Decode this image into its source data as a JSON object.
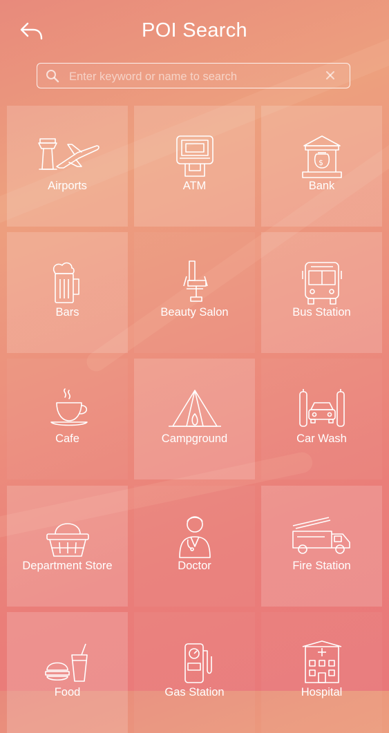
{
  "header": {
    "title": "POI Search"
  },
  "search": {
    "placeholder": "Enter keyword or name to search",
    "value": ""
  },
  "categories": [
    {
      "label": "Airports",
      "icon": "airport-icon"
    },
    {
      "label": "ATM",
      "icon": "atm-icon"
    },
    {
      "label": "Bank",
      "icon": "bank-icon"
    },
    {
      "label": "Bars",
      "icon": "beer-mug-icon"
    },
    {
      "label": "Beauty Salon",
      "icon": "salon-chair-icon"
    },
    {
      "label": "Bus Station",
      "icon": "bus-icon"
    },
    {
      "label": "Cafe",
      "icon": "coffee-cup-icon"
    },
    {
      "label": "Campground",
      "icon": "tent-icon"
    },
    {
      "label": "Car Wash",
      "icon": "car-wash-icon"
    },
    {
      "label": "Department Store",
      "icon": "shopping-basket-icon"
    },
    {
      "label": "Doctor",
      "icon": "doctor-icon"
    },
    {
      "label": "Fire Station",
      "icon": "fire-truck-icon"
    },
    {
      "label": "Food",
      "icon": "burger-drink-icon"
    },
    {
      "label": "Gas Station",
      "icon": "gas-pump-icon"
    },
    {
      "label": "Hospital",
      "icon": "hospital-icon"
    }
  ]
}
